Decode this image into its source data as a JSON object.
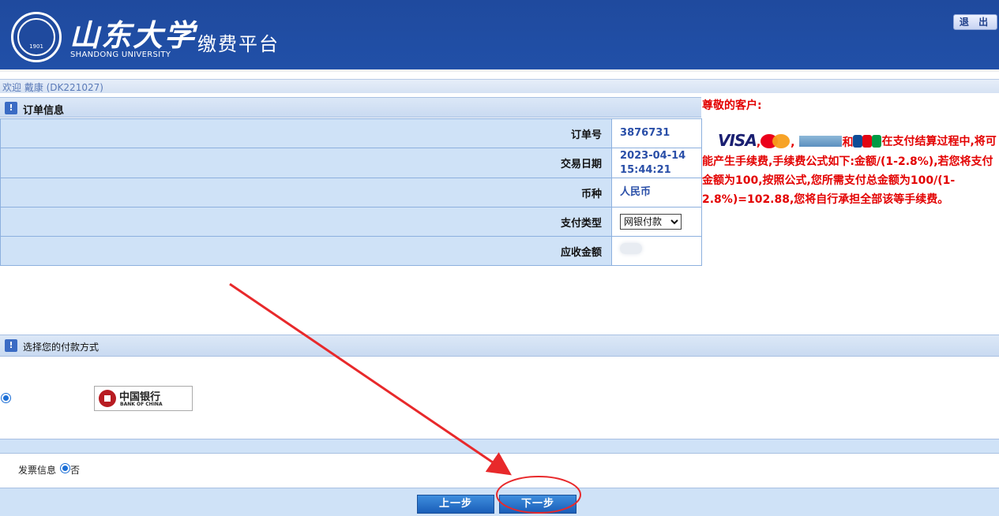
{
  "header": {
    "logo_cn": "山东大学",
    "logo_en": "SHANDONG UNIVERSITY",
    "seal_year": "1901",
    "site_title": "缴费平台",
    "logout_label": "退 出"
  },
  "welcome": "欢迎 戴康 (DK221027)",
  "order": {
    "section_title": "订单信息",
    "rows": [
      {
        "label": "订单号",
        "value": "3876731"
      },
      {
        "label": "交易日期",
        "value": "2023-04-14 15:44:21"
      },
      {
        "label": "币种",
        "value": "人民币"
      },
      {
        "label": "支付类型",
        "value": "网银付款"
      },
      {
        "label": "应收金额",
        "value": ""
      }
    ],
    "pay_type_options": [
      "网银付款"
    ]
  },
  "notice": {
    "greeting": "尊敬的客户:",
    "card_visa": "VISA",
    "sep1": ",",
    "sep2": ",",
    "conj": "和",
    "text": "在支付结算过程中,将可能产生手续费,手续费公式如下:金额/(1-2.8%),若您将支付金额为100,按照公式,您所需支付总金额为100/(1-2.8%)=102.88,您将自行承担全部该等手续费。"
  },
  "payment": {
    "section_title": "选择您的付款方式",
    "bank_cn": "中国银行",
    "bank_en": "BANK OF CHINA"
  },
  "invoice": {
    "label": "发票信息",
    "option_no": "否"
  },
  "buttons": {
    "prev": "上一步",
    "next": "下一步"
  },
  "colors": {
    "header_bg": "#2150a8",
    "notice_text": "#e30000",
    "annotation": "#e8292b",
    "button_bg": "#1a5eb8"
  }
}
